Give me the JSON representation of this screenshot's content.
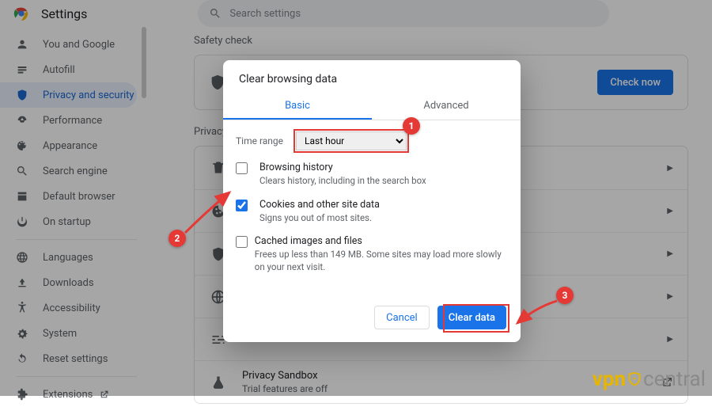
{
  "header": {
    "title": "Settings",
    "search_placeholder": "Search settings"
  },
  "sidebar": {
    "items": [
      {
        "label": "You and Google"
      },
      {
        "label": "Autofill"
      },
      {
        "label": "Privacy and security"
      },
      {
        "label": "Performance"
      },
      {
        "label": "Appearance"
      },
      {
        "label": "Search engine"
      },
      {
        "label": "Default browser"
      },
      {
        "label": "On startup"
      }
    ],
    "items2": [
      {
        "label": "Languages"
      },
      {
        "label": "Downloads"
      },
      {
        "label": "Accessibility"
      },
      {
        "label": "System"
      },
      {
        "label": "Reset settings"
      }
    ],
    "extensions": "Extensions"
  },
  "main": {
    "safety_label": "Safety check",
    "check_now": "Check now",
    "privsec_label": "Privacy and security",
    "rows": [
      {
        "icon": "trash"
      },
      {
        "icon": "cookie"
      },
      {
        "icon": "shield"
      },
      {
        "icon": "globe"
      },
      {
        "icon": "sliders"
      }
    ],
    "sandbox_title": "Privacy Sandbox",
    "sandbox_sub": "Trial features are off"
  },
  "dialog": {
    "title": "Clear browsing data",
    "tabs": {
      "basic": "Basic",
      "advanced": "Advanced"
    },
    "time_range_label": "Time range",
    "time_range_value": "Last hour",
    "opts": [
      {
        "title": "Browsing history",
        "sub": "Clears history, including in the search box",
        "checked": false
      },
      {
        "title": "Cookies and other site data",
        "sub": "Signs you out of most sites.",
        "checked": true
      },
      {
        "title": "Cached images and files",
        "sub": "Frees up less than 149 MB. Some sites may load more slowly on your next visit.",
        "checked": false
      }
    ],
    "cancel": "Cancel",
    "clear": "Clear data"
  },
  "annotations": {
    "n1": "1",
    "n2": "2",
    "n3": "3"
  },
  "watermark": {
    "vpn": "vpn",
    "central": "central"
  }
}
